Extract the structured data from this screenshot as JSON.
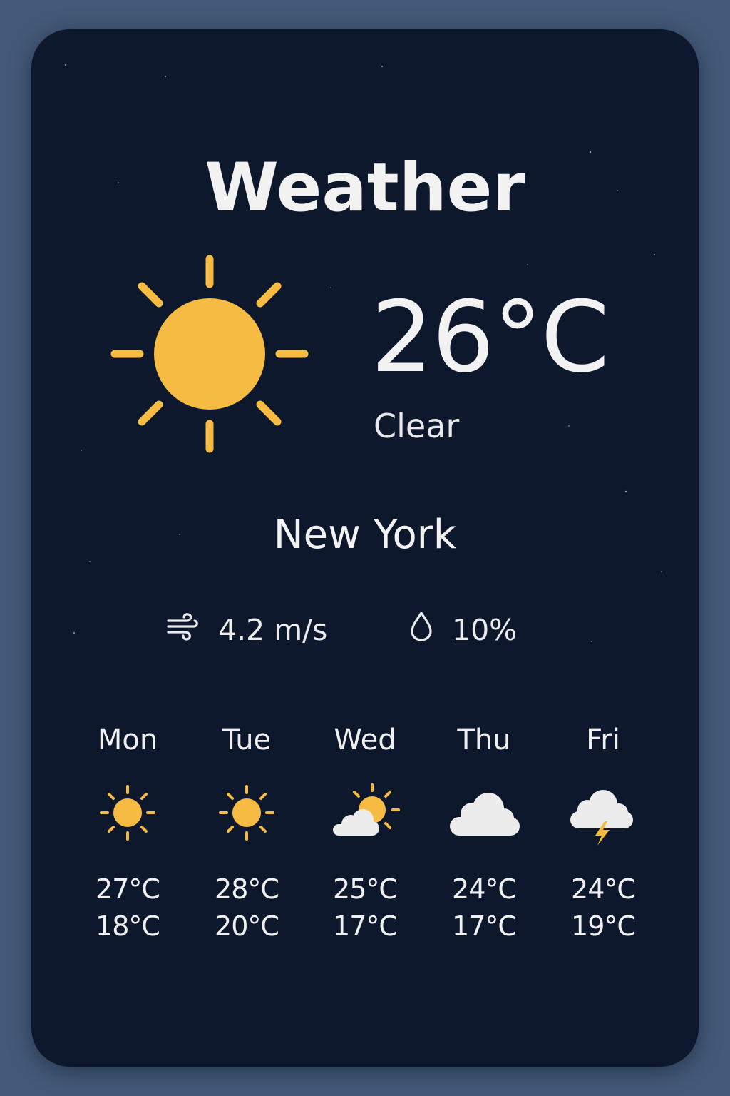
{
  "app": {
    "title": "Weather"
  },
  "current": {
    "temperature": "26°C",
    "condition": "Clear",
    "icon": "sun-icon",
    "city": "New York",
    "wind": "4.2 m/s",
    "wind_icon": "wind-icon",
    "precipitation": "10%",
    "precipitation_icon": "raindrop-icon"
  },
  "forecast": [
    {
      "day": "Mon",
      "icon": "sun-icon",
      "high": "27°C",
      "low": "18°C"
    },
    {
      "day": "Tue",
      "icon": "sun-icon",
      "high": "28°C",
      "low": "20°C"
    },
    {
      "day": "Wed",
      "icon": "partly-cloudy-icon",
      "high": "25°C",
      "low": "17°C"
    },
    {
      "day": "Thu",
      "icon": "cloud-icon",
      "high": "24°C",
      "low": "17°C"
    },
    {
      "day": "Fri",
      "icon": "thunderstorm-icon",
      "high": "24°C",
      "low": "19°C"
    }
  ],
  "colors": {
    "page_background": "#435a78",
    "card_background": "#0e182c",
    "sun": "#f6bb42",
    "cloud": "#ececec",
    "text": "#f2f2f2"
  }
}
